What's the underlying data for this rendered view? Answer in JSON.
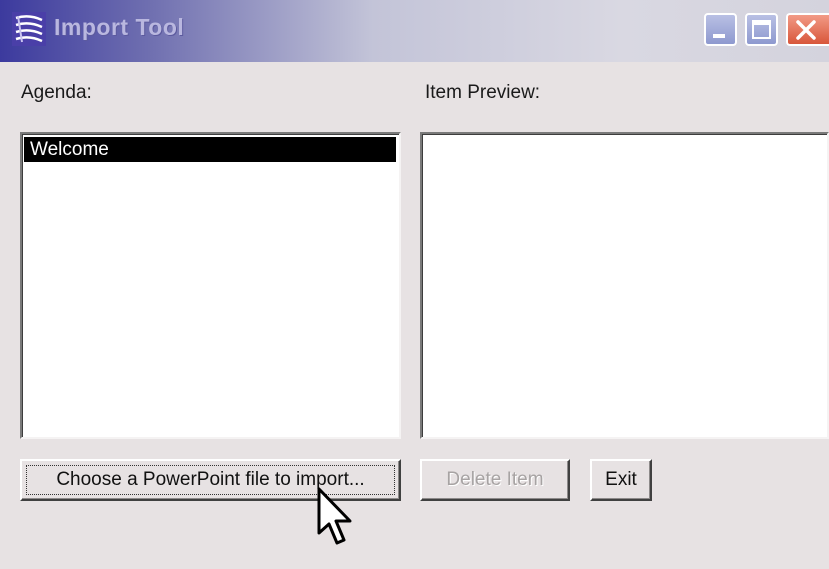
{
  "window": {
    "title": "Import Tool",
    "icon": "import-tool-app-icon"
  },
  "titlebar_buttons": {
    "minimize": "minimize-icon",
    "maximize": "maximize-icon",
    "close": "close-icon"
  },
  "agenda": {
    "label": "Agenda:",
    "items": [
      {
        "label": "Welcome",
        "selected": true
      }
    ]
  },
  "preview": {
    "label": "Item Preview:"
  },
  "buttons": {
    "choose_file": "Choose a PowerPoint file to import...",
    "delete_item": "Delete Item",
    "exit": "Exit"
  },
  "colors": {
    "selection_background": "#000000",
    "selection_text": "#ffffff",
    "disabled_text": "#a7a3a3",
    "close_button": "#d8563a"
  }
}
